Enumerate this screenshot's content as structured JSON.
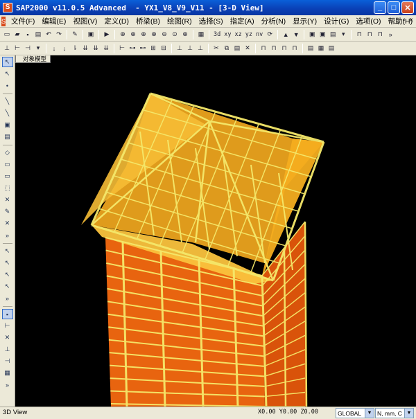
{
  "window": {
    "title": "SAP2000 v11.0.5 Advanced  - YX1_V8_V9_V11 - [3-D View]",
    "app_icon": "sap-logo-icon",
    "buttons": [
      "_",
      "□",
      "✕"
    ]
  },
  "menu": {
    "items": [
      "文件(F)",
      "编辑(E)",
      "视图(V)",
      "定义(D)",
      "桥梁(B)",
      "绘图(R)",
      "选择(S)",
      "指定(A)",
      "分析(N)",
      "显示(Y)",
      "设计(G)",
      "选项(O)",
      "帮助(H)"
    ],
    "mdi_buttons": [
      "_",
      "▫",
      "×"
    ]
  },
  "toolbar1": {
    "view_labels": [
      "3d",
      "xy",
      "xz",
      "yz",
      "nv"
    ]
  },
  "viewport": {
    "tab_label": "对象模型"
  },
  "statusbar": {
    "view_name": "3D View",
    "coords": "X0.00  Y0.00  Z0.00",
    "coord_system": "GLOBAL",
    "units": "N, mm, C"
  },
  "colors": {
    "roof_fill": "#f2a81e",
    "wall_fill": "#e8640f",
    "frame": "#f5e86a",
    "background": "#000000"
  }
}
